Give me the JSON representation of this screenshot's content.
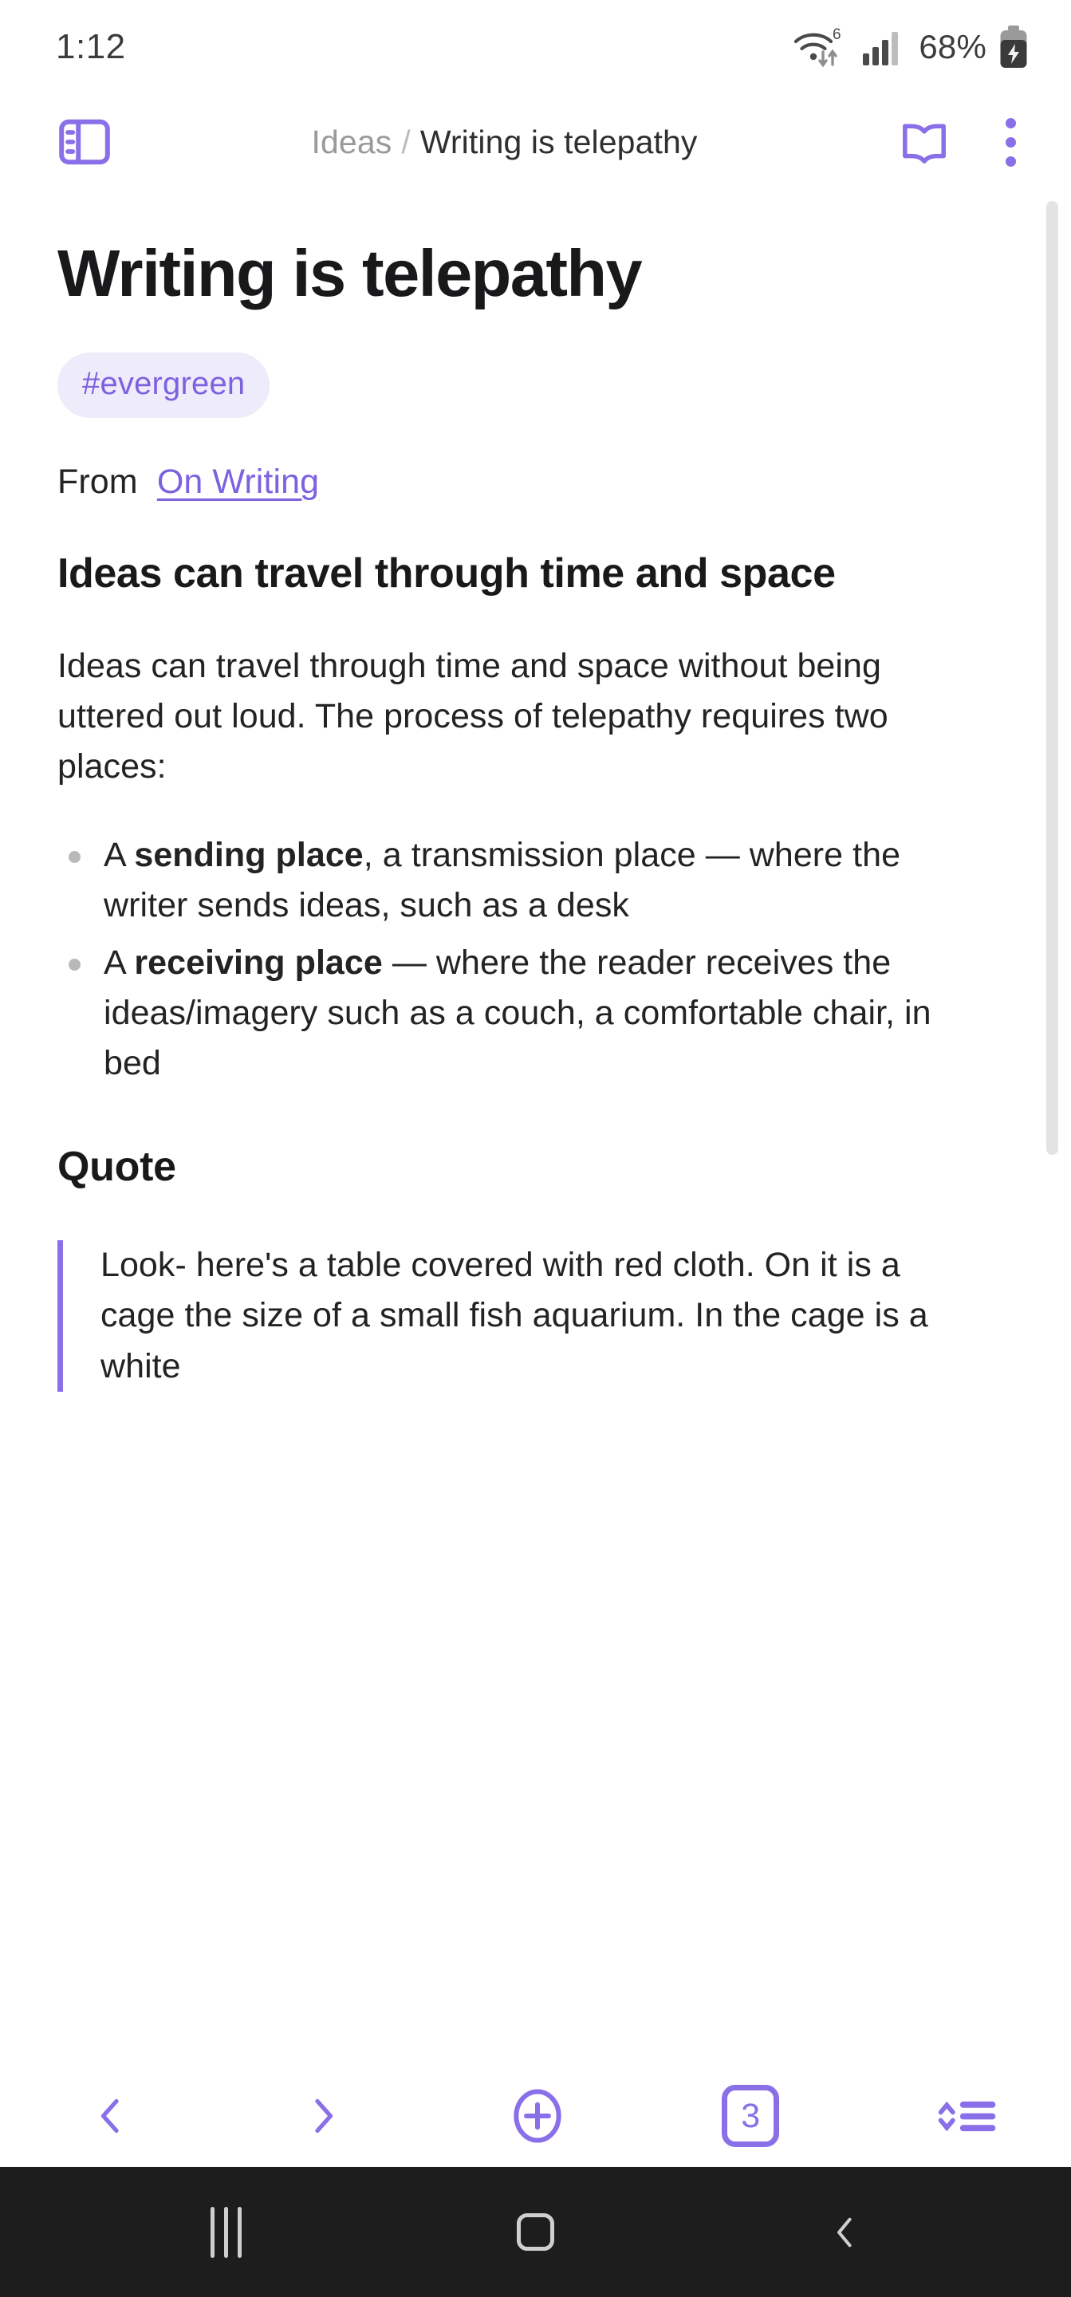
{
  "status_bar": {
    "clock": "1:12",
    "wifi_generation": "6",
    "battery_percent": "68%",
    "icons": [
      "wifi-6-icon",
      "cellular-signal-icon",
      "battery-charging-icon"
    ]
  },
  "appbar": {
    "sidebar_toggle_icon": "sidebar-panel-icon",
    "breadcrumb": {
      "parent": "Ideas",
      "separator": "/",
      "current": "Writing is telepathy"
    },
    "reading_mode_icon": "open-book-icon",
    "overflow_menu_icon": "more-vertical-icon"
  },
  "document": {
    "title": "Writing is telepathy",
    "tags": [
      "#evergreen"
    ],
    "source_prefix": "From",
    "source_link": "On Writing",
    "heading_1": "Ideas can travel through time and space",
    "paragraph_1": "Ideas can travel through time and space without being uttered out loud. The process of telepathy requires two places:",
    "bullets": [
      {
        "lead": "A ",
        "bold": "sending place",
        "rest": ", a transmission place — where the writer sends ideas, such as a desk"
      },
      {
        "lead": "A ",
        "bold": "receiving place",
        "rest": " — where the reader receives the ideas/imagery such as a couch, a comfortable chair, in bed"
      }
    ],
    "heading_2": "Quote",
    "blockquote": "Look- here's a table covered with red cloth. On it is a cage the size of a small fish aquarium. In the cage is a white"
  },
  "toolbar": {
    "back_label": "‹",
    "forward_label": "›",
    "new_note_icon": "plus-circle-icon",
    "tab_count": "3",
    "sort_icon": "sort-list-icon"
  },
  "navbar": {
    "recents_icon": "recents-icon",
    "home_icon": "home-icon",
    "back_icon": "back-chevron-icon"
  },
  "colors": {
    "accent": "#8a70e8",
    "accent_text": "#7c62e0",
    "tag_bg": "#eeebfa",
    "body_text": "#232323",
    "muted_text": "#9a9a9a",
    "navbar_bg": "#1d1d1d"
  }
}
